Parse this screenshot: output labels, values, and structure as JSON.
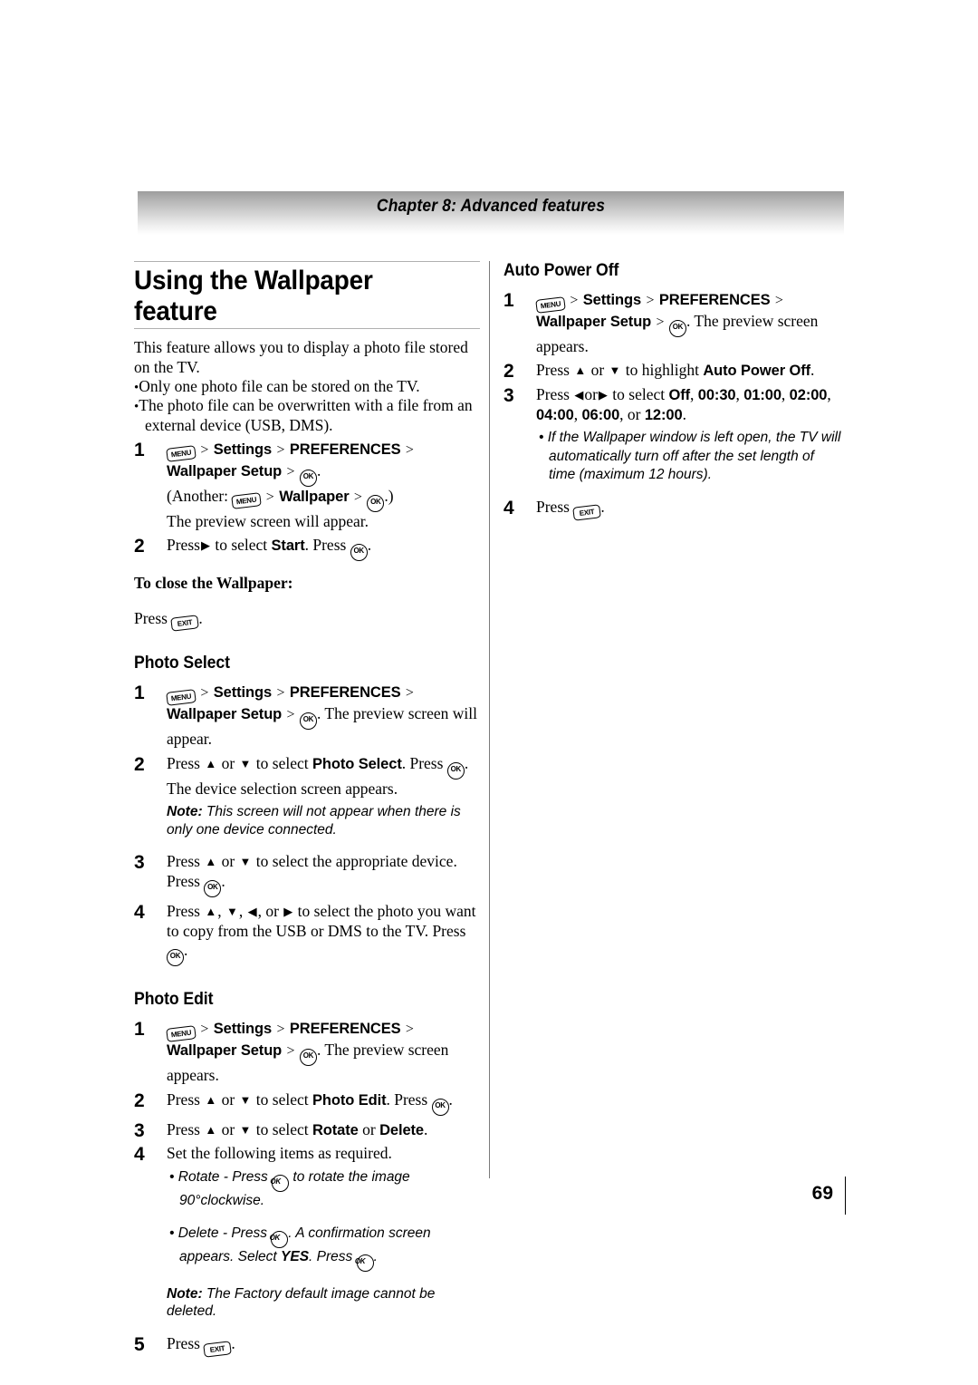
{
  "chapter": {
    "banner_title": "Chapter 8: Advanced features"
  },
  "page_number": "69",
  "left_column": {
    "title": "Using the Wallpaper feature",
    "intro": "This feature allows you to display a photo file stored on the TV.",
    "intro_bullets": [
      "Only one photo file can be stored on the TV.",
      "The photo file can be overwritten with a file from an external device (USB, DMS)."
    ],
    "steps": [
      {
        "num": "1",
        "path_prefix": "",
        "menu_key": "MENU",
        "sep": ">",
        "items": [
          "Settings",
          "PREFERENCES",
          "Wallpaper Setup"
        ],
        "ok_key": "OK",
        "another_label": "(Another:",
        "another_item": "Wallpaper",
        "another_close": ".)",
        "tail": "The preview screen will appear."
      },
      {
        "num": "2",
        "text_before": "Press",
        "arrow": "▶",
        "text_mid": "to select",
        "target": "Start",
        "text_after": ". Press",
        "ok_key": "OK",
        "text_end": "."
      }
    ],
    "close_heading": "To close the Wallpaper:",
    "close_text": "Press",
    "close_key": "EXIT",
    "close_end": ".",
    "photo_select": {
      "heading": "Photo Select",
      "steps": [
        {
          "num": "1",
          "menu_key": "MENU",
          "items": [
            "Settings",
            "PREFERENCES",
            "Wallpaper Setup"
          ],
          "ok_key": "OK",
          "tail": ". The preview screen will appear."
        },
        {
          "num": "2",
          "text_before": "Press",
          "arrow_up": "▲",
          "or": "or",
          "arrow_down": "▼",
          "text_mid": "to select",
          "target": "Photo Select",
          "text_after": ". Press",
          "ok_key": "OK",
          "text_end": ". The device selection screen appears."
        }
      ],
      "note_label": "Note:",
      "note_text": " This screen will not appear when there is only one device connected.",
      "steps2": [
        {
          "num": "3",
          "text_before": "Press",
          "arrow_up": "▲",
          "or": "or",
          "arrow_down": "▼",
          "text_mid": "to select the appropriate device. Press",
          "ok_key": "OK",
          "text_end": "."
        },
        {
          "num": "4",
          "text_before": "Press",
          "arrow_up": "▲",
          "arrow_down": "▼",
          "arrow_left": "◀",
          "arrow_right": "▶",
          "or": "or",
          "text_mid": "to select the photo you want to copy from the USB or DMS to the TV. Press",
          "ok_key": "OK",
          "text_end": "."
        }
      ]
    },
    "photo_edit": {
      "heading": "Photo Edit",
      "steps": [
        {
          "num": "1",
          "menu_key": "MENU",
          "items": [
            "Settings",
            "PREFERENCES",
            "Wallpaper Setup"
          ],
          "ok_key": "OK",
          "tail": ". The preview screen appears."
        },
        {
          "num": "2",
          "text_before": "Press",
          "arrow_up": "▲",
          "or": "or",
          "arrow_down": "▼",
          "text_mid": "to select",
          "target": "Photo Edit",
          "text_after": ". Press",
          "ok_key": "OK",
          "text_end": "."
        },
        {
          "num": "3",
          "text_before": "Press",
          "arrow_up": "▲",
          "or": "or",
          "arrow_down": "▼",
          "text_mid": "to select",
          "target": "Rotate",
          "target_or": "or",
          "target2": "Delete",
          "text_end": "."
        },
        {
          "num": "4",
          "text": "Set the following items as required."
        }
      ],
      "sub_bullets": [
        {
          "lead": "Rotate - Press",
          "key": "OK",
          "tail": " to rotate the image 90°clockwise."
        },
        {
          "lead": "Delete - Press",
          "key": "OK",
          "tail": ". A confirmation screen appears. Select ",
          "bold": "YES",
          "tail2": ". Press ",
          "key2": "OK",
          "tail3": "."
        }
      ],
      "note_label": "Note:",
      "note_text": " The Factory default image cannot be deleted.",
      "final_step": {
        "num": "5",
        "text": "Press",
        "key": "EXIT",
        "end": "."
      }
    }
  },
  "right_column": {
    "heading": "Auto Power Off",
    "steps": [
      {
        "num": "1",
        "menu_key": "MENU",
        "items": [
          "Settings",
          "PREFERENCES",
          "Wallpaper Setup"
        ],
        "ok_key": "OK",
        "tail": ". The preview screen appears."
      },
      {
        "num": "2",
        "text_before": "Press",
        "arrow_up": "▲",
        "or": "or",
        "arrow_down": "▼",
        "text_mid": "to highlight",
        "target": "Auto Power Off",
        "text_end": "."
      },
      {
        "num": "3",
        "text_before": "Press",
        "arrow_left": "◀",
        "or": "or",
        "arrow_right": "▶",
        "text_mid": "to select",
        "options": [
          "Off",
          "00:30",
          "01:00",
          "02:00",
          "04:00",
          "06:00"
        ],
        "options_or": "or",
        "option_last": "12:00",
        "text_end": "."
      }
    ],
    "sub_bullet": "If the Wallpaper window is left open, the TV will automatically turn off after the set length of time (maximum 12 hours).",
    "final_step": {
      "num": "4",
      "text": "Press",
      "key": "EXIT",
      "end": "."
    }
  }
}
